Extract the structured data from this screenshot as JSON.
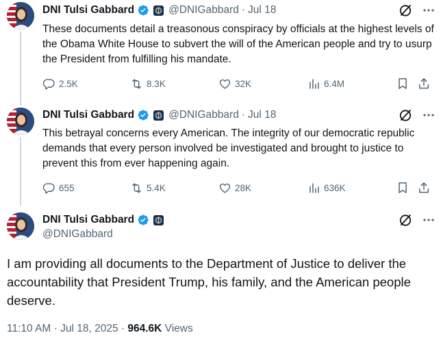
{
  "tweets": [
    {
      "name": "DNI Tulsi Gabbard",
      "handle": "@DNIGabbard",
      "date": "Jul 18",
      "text": "These documents detail a treasonous conspiracy by officials at the highest levels of the Obama White House to subvert the will of the American people and try to usurp the President from fulfilling his mandate.",
      "replies": "2.5K",
      "reposts": "8.3K",
      "likes": "32K",
      "views": "6.4M"
    },
    {
      "name": "DNI Tulsi Gabbard",
      "handle": "@DNIGabbard",
      "date": "Jul 18",
      "text": "This betrayal concerns every American. The integrity of our democratic republic demands that every person involved be investigated and brought to justice to prevent this from ever happening again.",
      "replies": "655",
      "reposts": "5.4K",
      "likes": "28K",
      "views": "636K"
    }
  ],
  "focal": {
    "name": "DNI Tulsi Gabbard",
    "handle": "@DNIGabbard",
    "text": "I am providing all documents to the Department of Justice to deliver the accountability that President Trump, his family, and the American people deserve.",
    "time": "11:10 AM · Jul 18, 2025",
    "separator": "·",
    "views_count": "964.6K",
    "views_label": "Views"
  },
  "icons": {
    "verified": "verified-badge-icon",
    "affiliate": "government-affiliate-badge-icon",
    "grok": "grok-icon",
    "more": "more-icon",
    "reply": "reply-icon",
    "repost": "repost-icon",
    "like": "like-icon",
    "views": "views-icon",
    "bookmark": "bookmark-icon",
    "share": "share-icon"
  },
  "colors": {
    "verified_blue": "#1d9bf0",
    "secondary_text": "#536471",
    "primary_text": "#0f1419",
    "thread_line": "#cfd9de"
  }
}
